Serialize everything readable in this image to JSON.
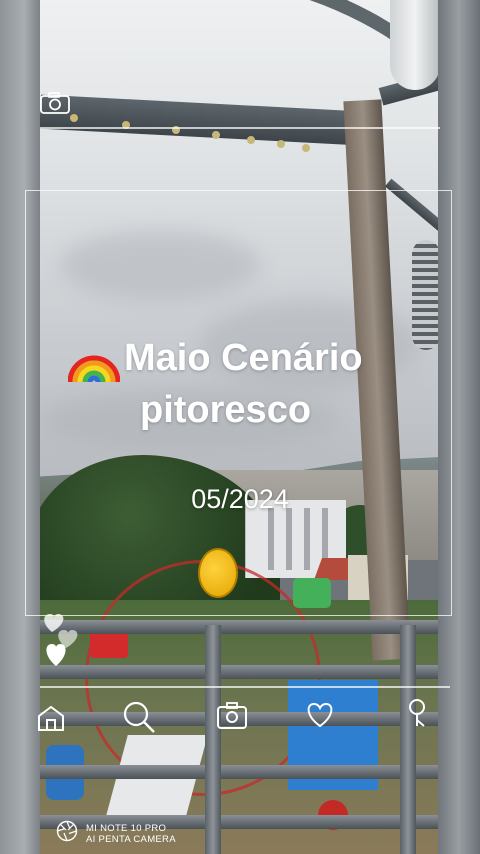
{
  "story": {
    "title_line1": "Maio Cenário",
    "title_line2": "pitoresco",
    "emoji": "rainbow",
    "date": "05/2024"
  },
  "icons": {
    "top_left": "camera-icon",
    "hearts": "hearts-icon",
    "bottom_bar": [
      "home-icon",
      "search-icon",
      "camera-swap-icon",
      "heart-icon",
      "profile-icon"
    ]
  },
  "watermark": {
    "line1": "MI NOTE 10 PRO",
    "line2": "AI PENTA CAMERA",
    "logo": "aperture-icon"
  }
}
